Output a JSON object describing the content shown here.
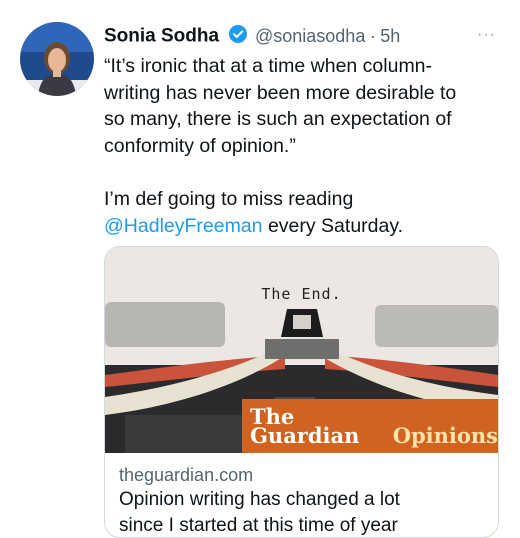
{
  "author": {
    "name": "Sonia Sodha",
    "handle": "@soniasodha",
    "separator": "·",
    "time": "5h",
    "verified_icon": "verified-badge-icon",
    "avatar_icon": "profile-photo"
  },
  "more_label": "···",
  "tweet": {
    "quote_lines": [
      "“It’s ironic that at a time when column-",
      "writing has never been more desirable to",
      "so many, there is such an expectation of",
      "conformity of opinion.”"
    ],
    "line2_prefix": "I’m def going to miss reading",
    "mention": "@HadleyFreeman",
    "line2_suffix": " every Saturday."
  },
  "card": {
    "image_caption": "The End.",
    "brand_word": "The Guardian",
    "brand_suffix": "Opinions",
    "domain": "theguardian.com",
    "headline": "Opinion writing has changed a lot",
    "headline_cut": "since I started at this time of year"
  },
  "colors": {
    "link": "#1d9bf0",
    "muted": "#536471",
    "brand_orange": "#d0631f"
  }
}
